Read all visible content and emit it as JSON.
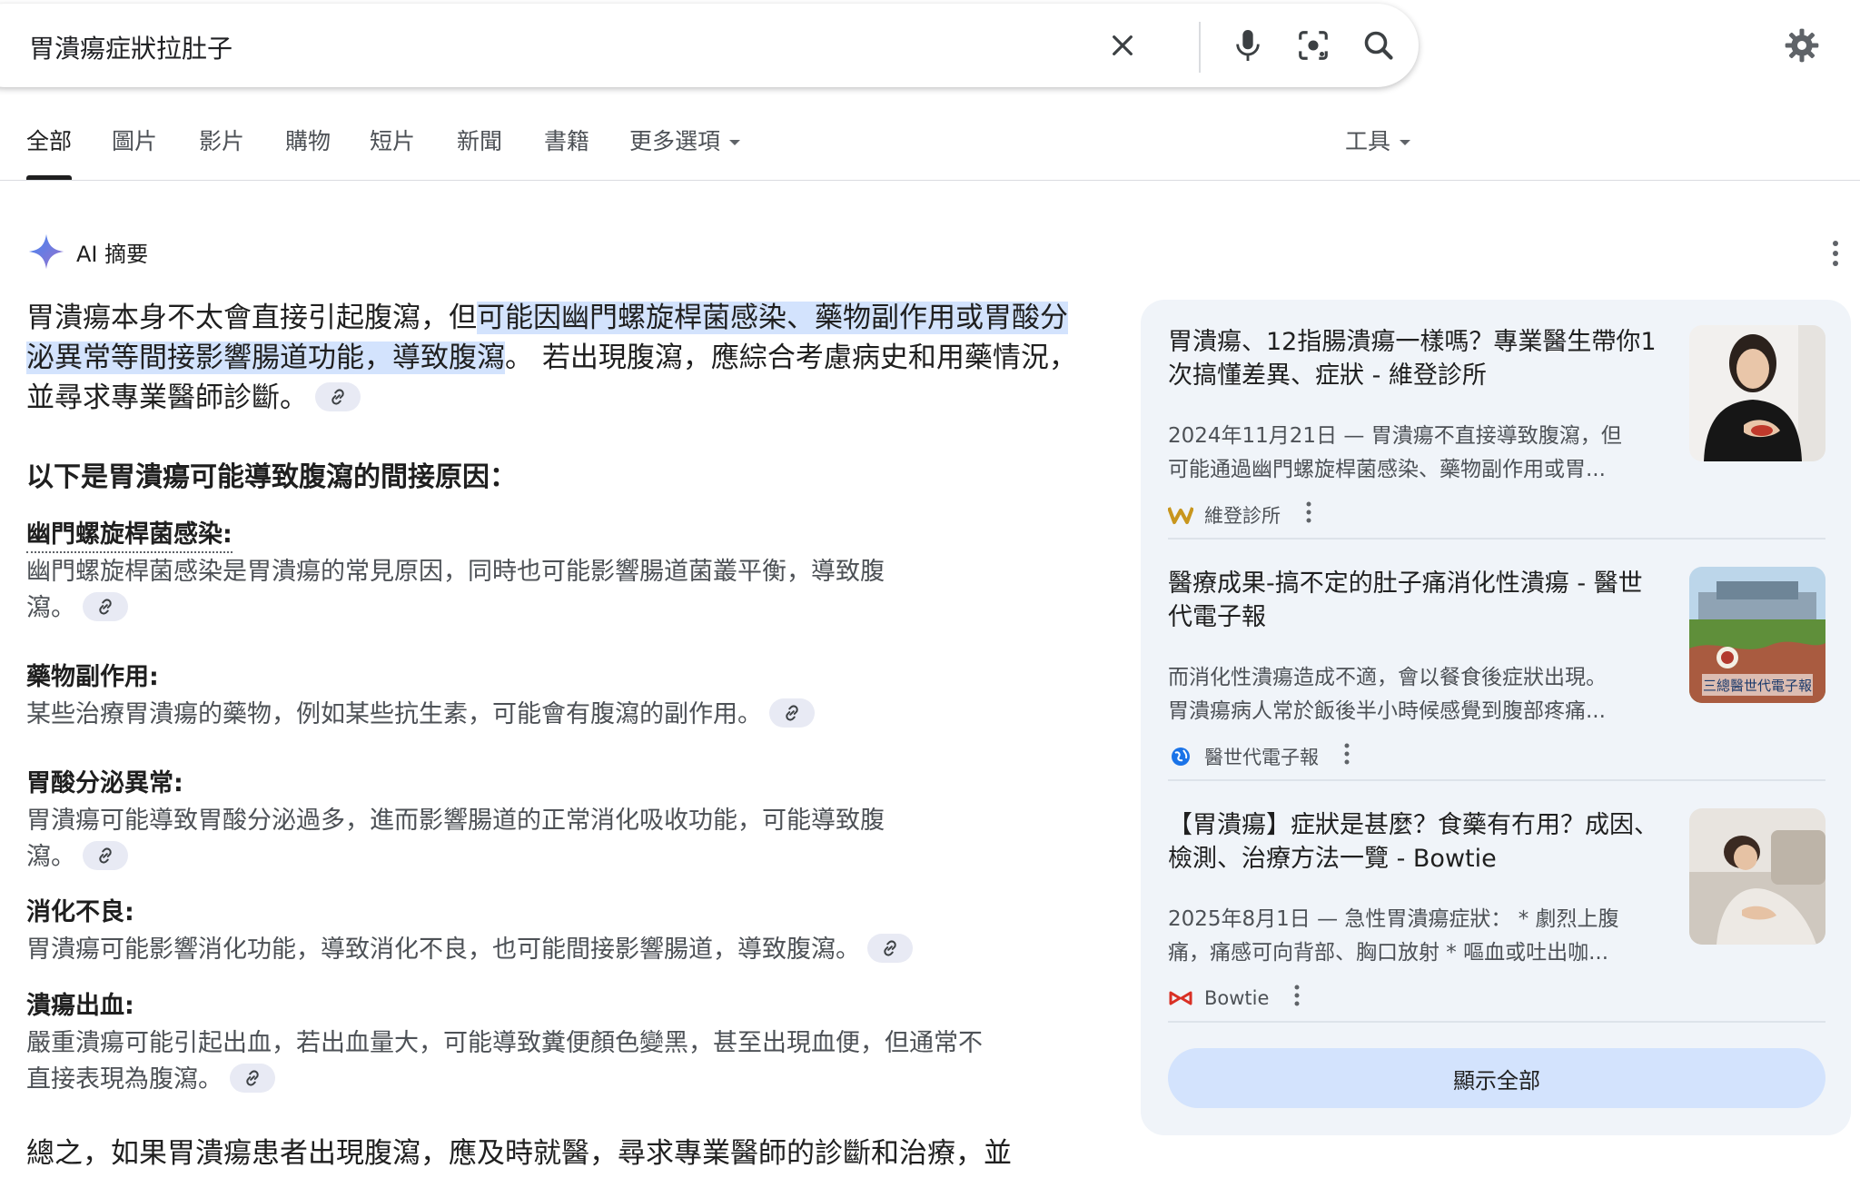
{
  "search": {
    "query": "胃潰瘍症狀拉肚子",
    "icons": [
      "clear-icon",
      "microphone-icon",
      "camera-lens-icon",
      "search-icon"
    ]
  },
  "settings_icon": "gear-icon",
  "tabs": [
    {
      "label": "全部",
      "active": true
    },
    {
      "label": "圖片"
    },
    {
      "label": "影片"
    },
    {
      "label": "購物"
    },
    {
      "label": "短片"
    },
    {
      "label": "新聞"
    },
    {
      "label": "書籍"
    },
    {
      "label": "更多選項"
    }
  ],
  "tools_label": "工具",
  "ai": {
    "title": "AI 摘要",
    "summary": {
      "part1": "胃潰瘍本身不太會直接引起腹瀉，但",
      "highlight": "可能因幽門螺旋桿菌感染、藥物副作用或胃酸分泌異常等間接影響腸道功能，導致腹瀉",
      "part2": "。 若出現腹瀉，應綜合考慮病史和用藥情況，並尋求專業醫師診斷。"
    },
    "heading": "以下是胃潰瘍可能導致腹瀉的間接原因：",
    "items": [
      {
        "title": "幽門螺旋桿菌感染:",
        "lines": [
          "幽門螺旋桿菌感染是胃潰瘍的常見原因，同時也可能影響腸道菌叢平衡，導致腹",
          "瀉。"
        ]
      },
      {
        "title": "藥物副作用:",
        "lines": [
          "某些治療胃潰瘍的藥物，例如某些抗生素，可能會有腹瀉的副作用。"
        ]
      },
      {
        "title": "胃酸分泌異常:",
        "lines": [
          "胃潰瘍可能導致胃酸分泌過多，進而影響腸道的正常消化吸收功能，可能導致腹",
          "瀉。"
        ]
      },
      {
        "title": "消化不良:",
        "lines": [
          "胃潰瘍可能影響消化功能，導致消化不良，也可能間接影響腸道，導致腹瀉。"
        ]
      },
      {
        "title": "潰瘍出血:",
        "lines": [
          "嚴重潰瘍可能引起出血，若出血量大，可能導致糞便顏色變黑，甚至出現血便，但通常不",
          "直接表現為腹瀉。"
        ]
      }
    ],
    "conclusion": "總之，如果胃潰瘍患者出現腹瀉，應及時就醫，尋求專業醫師的診斷和治療，並"
  },
  "sources": [
    {
      "title": "胃潰瘍、12指腸潰瘍一樣嗎？專業醫生帶你1次搞懂差異、症狀 - 維登診所",
      "snippet": [
        "2024年11月21日 — 胃潰瘍不直接導致腹瀉，但",
        "可能通過幽門螺旋桿菌感染、藥物副作用或胃..."
      ],
      "site": "維登診所",
      "logo_color": "#c8961e"
    },
    {
      "title": "醫療成果-搞不定的肚子痛消化性潰瘍 - 醫世代電子報",
      "snippet": [
        "而消化性潰瘍造成不適，會以餐食後症狀出現。",
        "胃潰瘍病人常於飯後半小時候感覺到腹部疼痛..."
      ],
      "site": "醫世代電子報",
      "thumb_text": "三總醫世代電子報",
      "logo_color": "#1a73e8"
    },
    {
      "title": "【胃潰瘍】症狀是甚麼？食藥有冇用？成因、檢測、治療方法一覽 - Bowtie",
      "snippet": [
        "2025年8月1日 — 急性胃潰瘍症狀： * 劇烈上腹",
        "痛，痛感可向背部、胸口放射 * 嘔血或吐出咖..."
      ],
      "site": "Bowtie",
      "logo_color": "#d93025"
    }
  ],
  "show_all_label": "顯示全部",
  "colors": {
    "accent": "#1a73e8",
    "highlight": "#d3e3fd",
    "panel": "#f0f4f9"
  }
}
